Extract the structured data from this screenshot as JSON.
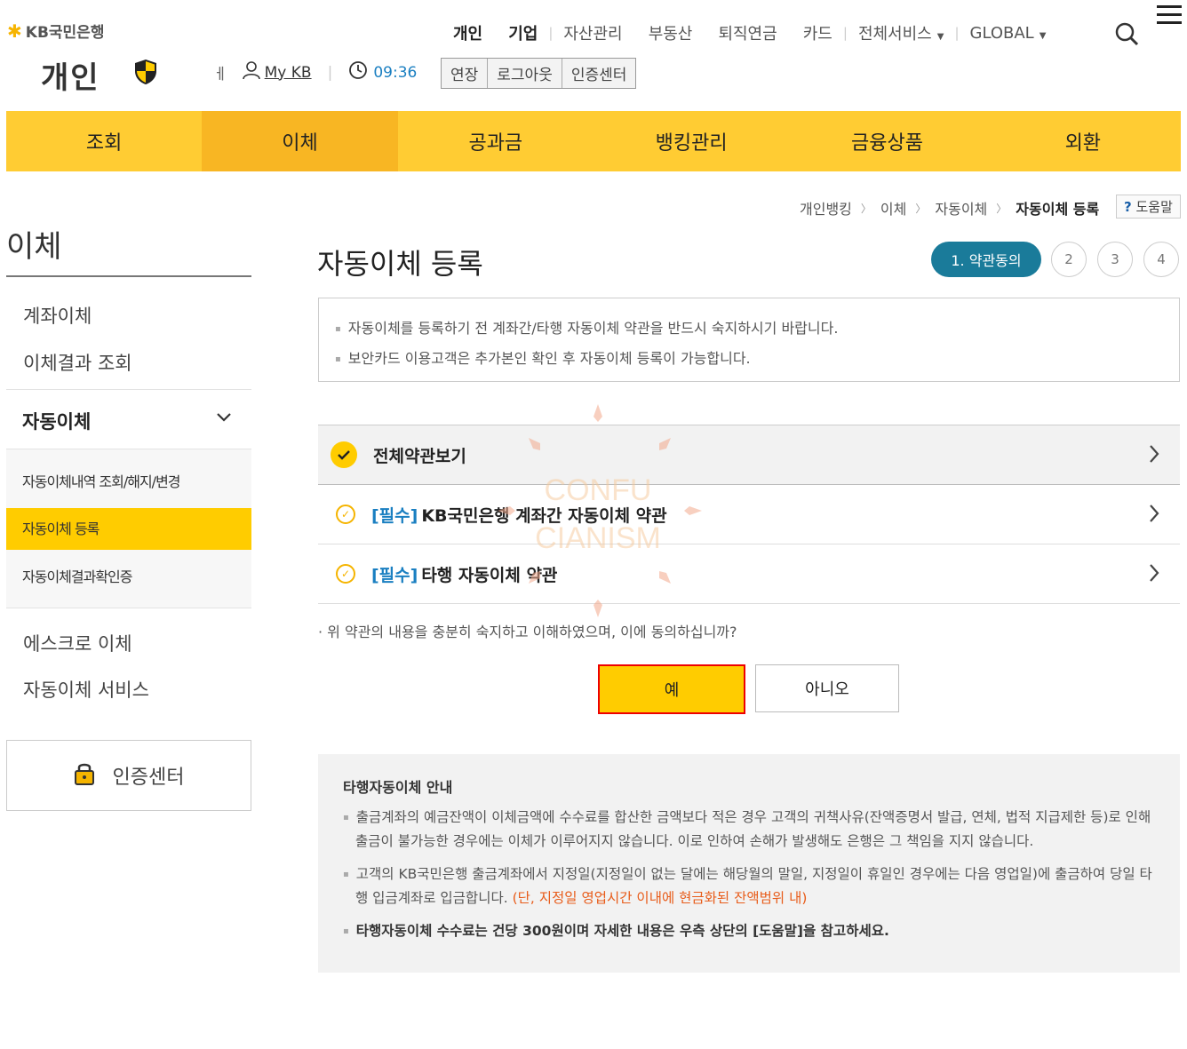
{
  "header": {
    "logo_text": "KB국민은행",
    "persona": "개인",
    "topnav": [
      "개인",
      "기업",
      "자산관리",
      "부동산",
      "퇴직연금",
      "카드",
      "전체서비스",
      "GLOBAL"
    ],
    "mykb": "My KB",
    "time": "09:36",
    "buttons": [
      "연장",
      "로그아웃",
      "인증센터"
    ]
  },
  "gnb": [
    "조회",
    "이체",
    "공과금",
    "뱅킹관리",
    "금융상품",
    "외환"
  ],
  "breadcrumb": [
    "개인뱅킹",
    "이체",
    "자동이체",
    "자동이체 등록"
  ],
  "help": "도움말",
  "lnb": {
    "title": "이체",
    "items": [
      "계좌이체",
      "이체결과 조회"
    ],
    "section": "자동이체",
    "subitems": [
      "자동이체내역 조회/해지/변경",
      "자동이체 등록",
      "자동이체결과확인증"
    ],
    "items2": [
      "에스크로 이체",
      "자동이체 서비스"
    ],
    "cert": "인증센터"
  },
  "main": {
    "title": "자동이체 등록",
    "steps": [
      "1. 약관동의",
      "2",
      "3",
      "4"
    ],
    "notice": [
      "자동이체를 등록하기 전 계좌간/타행 자동이체 약관을 반드시 숙지하시기 바랍니다.",
      "보안카드 이용고객은 추가본인 확인 후 자동이체 등록이 가능합니다."
    ],
    "terms_all": "전체약관보기",
    "terms": [
      {
        "tag": "[필수]",
        "label": "KB국민은행 계좌간 자동이체 약관"
      },
      {
        "tag": "[필수]",
        "label": "타행 자동이체 약관"
      }
    ],
    "question": "위 약관의 내용을 충분히 숙지하고 이해하였으며, 이에 동의하십니까?",
    "yes": "예",
    "no": "아니오"
  },
  "guide": {
    "title": "타행자동이체 안내",
    "p1": "출금계좌의 예금잔액이 이체금액에 수수료를 합산한 금액보다 적은 경우 고객의 귀책사유(잔액증명서 발급, 연체, 법적 지급제한 등)로 인해 출금이 불가능한 경우에는 이체가 이루어지지 않습니다. 이로 인하여 손해가 발생해도 은행은 그 책임을 지지 않습니다.",
    "p2": "고객의 KB국민은행 출금계좌에서 지정일(지정일이 없는 달에는 해당월의 말일, 지정일이 휴일인 경우에는 다음 영업일)에 출금하여 당일 타행 입금계좌로 입금합니다.",
    "p2_red": "(단, 지정일 영업시간 이내에 현금화된 잔액범위 내)",
    "p3": "타행자동이체 수수료는 건당 300원이며 자세한 내용은 우측 상단의 [도움말]을 참고하세요."
  },
  "watermark": {
    "line1": "CONFU",
    "line2": "CIANISM"
  },
  "colors": {
    "brand_yellow": "#ffcc33",
    "active_yellow": "#f8b623",
    "step_teal": "#1a7b9a",
    "required_blue": "#1a7fc1"
  }
}
